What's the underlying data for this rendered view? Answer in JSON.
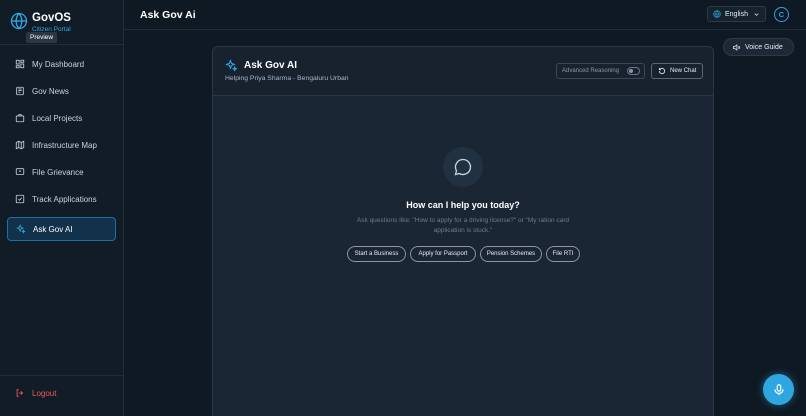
{
  "brand": {
    "title": "GovOS",
    "subtitle": "Citizen Portal",
    "tag": "Preview"
  },
  "sidebar": {
    "items": [
      {
        "label": "My Dashboard",
        "icon": "dashboard-icon"
      },
      {
        "label": "Gov News",
        "icon": "newspaper-icon"
      },
      {
        "label": "Local Projects",
        "icon": "briefcase-icon"
      },
      {
        "label": "Infrastructure Map",
        "icon": "map-icon"
      },
      {
        "label": "File Grievance",
        "icon": "grievance-icon"
      },
      {
        "label": "Track Applications",
        "icon": "checkbox-icon"
      },
      {
        "label": "Ask Gov AI",
        "icon": "sparkle-icon",
        "active": true
      }
    ],
    "logout_label": "Logout"
  },
  "header": {
    "title": "Ask Gov Ai",
    "language": "English",
    "avatar_initial": "C"
  },
  "chat": {
    "title": "Ask Gov AI",
    "subtitle": "Helping Priya Sharma - Bengaluru Urban",
    "advanced_label": "Advanced Reasoning",
    "advanced_enabled": false,
    "new_chat_label": "New Chat",
    "empty_title": "How can I help you today?",
    "empty_hint": "Ask questions like: \"How to apply for a driving license?\" or \"My ration card application is stuck.\"",
    "suggestions": [
      "Start a Business",
      "Apply for Passport",
      "Pension Schemes",
      "File RTI"
    ]
  },
  "voice_guide_label": "Voice Guide",
  "colors": {
    "accent": "#2ea7e0",
    "danger": "#ef5b5b",
    "background": "#0f1923",
    "panel": "#1a2633"
  }
}
